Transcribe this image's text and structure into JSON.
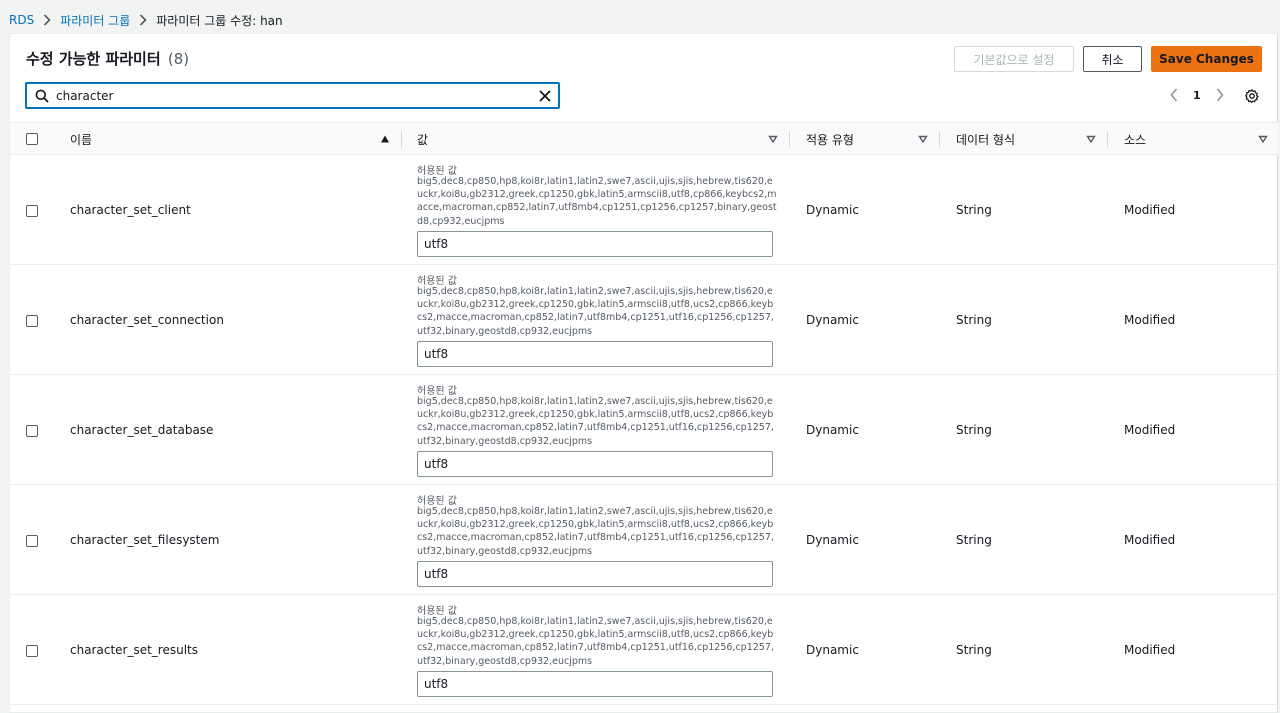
{
  "breadcrumb": {
    "items": [
      "RDS",
      "파라미터 그룹"
    ],
    "current": "파라미터 그룹 수정: han"
  },
  "panel": {
    "title": "수정 가능한 파라미터",
    "count": "(8)"
  },
  "actions": {
    "reset_label": "기본값으로 설정",
    "cancel_label": "취소",
    "save_label": "Save Changes"
  },
  "search": {
    "value": "character",
    "placeholder": ""
  },
  "pagination": {
    "current_page": "1"
  },
  "columns": {
    "name": "이름",
    "value": "값",
    "apply_type": "적용 유형",
    "data_type": "데이터 형식",
    "source": "소스"
  },
  "rows": [
    {
      "name": "character_set_client",
      "allowed_label": "허용된 값",
      "allowed_values": "big5,dec8,cp850,hp8,koi8r,latin1,latin2,swe7,ascii,ujis,sjis,hebrew,tis620,euckr,koi8u,gb2312,greek,cp1250,gbk,latin5,armscii8,utf8,cp866,keybcs2,macce,macroman,cp852,latin7,utf8mb4,cp1251,cp1256,cp1257,binary,geostd8,cp932,eucjpms",
      "value": "utf8",
      "apply_type": "Dynamic",
      "data_type": "String",
      "source": "Modified"
    },
    {
      "name": "character_set_connection",
      "allowed_label": "허용된 값",
      "allowed_values": "big5,dec8,cp850,hp8,koi8r,latin1,latin2,swe7,ascii,ujis,sjis,hebrew,tis620,euckr,koi8u,gb2312,greek,cp1250,gbk,latin5,armscii8,utf8,ucs2,cp866,keybcs2,macce,macroman,cp852,latin7,utf8mb4,cp1251,utf16,cp1256,cp1257,utf32,binary,geostd8,cp932,eucjpms",
      "value": "utf8",
      "apply_type": "Dynamic",
      "data_type": "String",
      "source": "Modified"
    },
    {
      "name": "character_set_database",
      "allowed_label": "허용된 값",
      "allowed_values": "big5,dec8,cp850,hp8,koi8r,latin1,latin2,swe7,ascii,ujis,sjis,hebrew,tis620,euckr,koi8u,gb2312,greek,cp1250,gbk,latin5,armscii8,utf8,ucs2,cp866,keybcs2,macce,macroman,cp852,latin7,utf8mb4,cp1251,utf16,cp1256,cp1257,utf32,binary,geostd8,cp932,eucjpms",
      "value": "utf8",
      "apply_type": "Dynamic",
      "data_type": "String",
      "source": "Modified"
    },
    {
      "name": "character_set_filesystem",
      "allowed_label": "허용된 값",
      "allowed_values": "big5,dec8,cp850,hp8,koi8r,latin1,latin2,swe7,ascii,ujis,sjis,hebrew,tis620,euckr,koi8u,gb2312,greek,cp1250,gbk,latin5,armscii8,utf8,ucs2,cp866,keybcs2,macce,macroman,cp852,latin7,utf8mb4,cp1251,utf16,cp1256,cp1257,utf32,binary,geostd8,cp932,eucjpms",
      "value": "utf8",
      "apply_type": "Dynamic",
      "data_type": "String",
      "source": "Modified"
    },
    {
      "name": "character_set_results",
      "allowed_label": "허용된 값",
      "allowed_values": "big5,dec8,cp850,hp8,koi8r,latin1,latin2,swe7,ascii,ujis,sjis,hebrew,tis620,euckr,koi8u,gb2312,greek,cp1250,gbk,latin5,armscii8,utf8,ucs2,cp866,keybcs2,macce,macroman,cp852,latin7,utf8mb4,cp1251,utf16,cp1256,cp1257,utf32,binary,geostd8,cp932,eucjpms",
      "value": "utf8",
      "apply_type": "Dynamic",
      "data_type": "String",
      "source": "Modified"
    }
  ],
  "icons": {
    "search": "search-icon",
    "clear": "close-icon",
    "prev": "chevron-left-icon",
    "next": "chevron-right-icon",
    "settings": "gear-icon",
    "sort_asc": "sort-ascending-icon",
    "filter": "caret-down-icon"
  },
  "colors": {
    "link": "#0073bb",
    "primary": "#ec7211",
    "focus": "#0073bb"
  }
}
